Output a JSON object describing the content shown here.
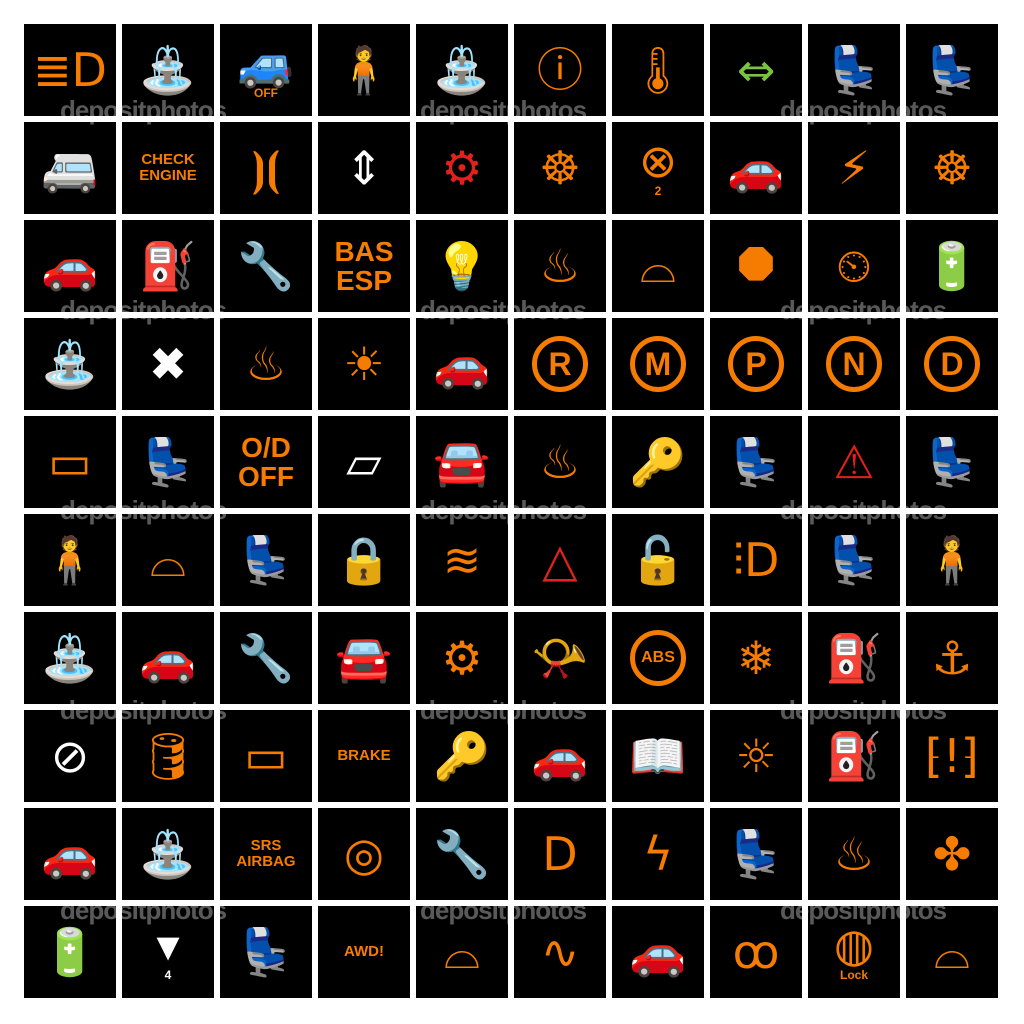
{
  "colors": {
    "orange": "#f57c00",
    "white": "#ffffff",
    "red": "#e3201b",
    "green": "#7cc242",
    "background": "#000000"
  },
  "watermark": "depositphotos",
  "icons": [
    {
      "name": "high-beam",
      "color": "orange"
    },
    {
      "name": "windshield-washer",
      "color": "orange"
    },
    {
      "name": "hill-descent-off",
      "color": "orange",
      "label": "OFF"
    },
    {
      "name": "seatbelt",
      "color": "orange"
    },
    {
      "name": "washer-wiper",
      "color": "orange"
    },
    {
      "name": "brake-warning",
      "color": "orange"
    },
    {
      "name": "coolant-temperature",
      "color": "orange"
    },
    {
      "name": "turn-signals",
      "color": "green"
    },
    {
      "name": "passenger-airbag",
      "color": "orange"
    },
    {
      "name": "side-airbag",
      "color": "orange"
    },
    {
      "name": "car-side",
      "color": "orange"
    },
    {
      "name": "check-engine",
      "color": "orange",
      "text": "CHECK\nENGINE"
    },
    {
      "name": "parking-lights",
      "color": "orange"
    },
    {
      "name": "power-window",
      "color": "white"
    },
    {
      "name": "transmission-warning",
      "color": "red"
    },
    {
      "name": "steering-wheel",
      "color": "orange"
    },
    {
      "name": "airbag-off",
      "color": "orange",
      "label": "2"
    },
    {
      "name": "hood-open",
      "color": "orange"
    },
    {
      "name": "fuse",
      "color": "orange"
    },
    {
      "name": "steering-wheel-lock",
      "color": "orange"
    },
    {
      "name": "convertible",
      "color": "orange"
    },
    {
      "name": "low-fuel",
      "color": "orange"
    },
    {
      "name": "wrench",
      "color": "orange"
    },
    {
      "name": "bas-esp",
      "color": "orange",
      "text": "BAS\nESP",
      "big": true
    },
    {
      "name": "bulb-failure",
      "color": "orange"
    },
    {
      "name": "seat-heater",
      "color": "orange"
    },
    {
      "name": "windshield-wiper",
      "color": "orange"
    },
    {
      "name": "brake-pad",
      "color": "orange"
    },
    {
      "name": "cruise-control",
      "color": "orange"
    },
    {
      "name": "battery",
      "color": "orange"
    },
    {
      "name": "washer-fluid",
      "color": "orange"
    },
    {
      "name": "window-fault",
      "color": "white"
    },
    {
      "name": "rear-defrost",
      "color": "orange"
    },
    {
      "name": "interior-light",
      "color": "orange"
    },
    {
      "name": "sedan",
      "color": "orange"
    },
    {
      "name": "gear-r",
      "color": "orange",
      "circle": "R"
    },
    {
      "name": "gear-m",
      "color": "orange",
      "circle": "M"
    },
    {
      "name": "gear-p",
      "color": "orange",
      "circle": "P"
    },
    {
      "name": "gear-n",
      "color": "orange",
      "circle": "N"
    },
    {
      "name": "gear-d",
      "color": "orange",
      "circle": "D"
    },
    {
      "name": "rear-wiper",
      "color": "orange"
    },
    {
      "name": "passenger-seat",
      "color": "orange"
    },
    {
      "name": "overdrive-off",
      "color": "orange",
      "text": "O/D\nOFF",
      "big": true
    },
    {
      "name": "door-open",
      "color": "white"
    },
    {
      "name": "traction-control",
      "color": "orange"
    },
    {
      "name": "rear-window-defrost",
      "color": "orange"
    },
    {
      "name": "child-lock",
      "color": "white"
    },
    {
      "name": "seat-heating",
      "color": "orange"
    },
    {
      "name": "warning-triangle",
      "color": "red"
    },
    {
      "name": "seatbelt-airbag",
      "color": "orange"
    },
    {
      "name": "airbag-passenger",
      "color": "orange"
    },
    {
      "name": "windshield-defrost",
      "color": "orange"
    },
    {
      "name": "child-seat",
      "color": "orange"
    },
    {
      "name": "car-lock",
      "color": "orange"
    },
    {
      "name": "washer-level",
      "color": "orange"
    },
    {
      "name": "hazard",
      "color": "red"
    },
    {
      "name": "door-locks",
      "color": "orange"
    },
    {
      "name": "fog-light",
      "color": "orange"
    },
    {
      "name": "ventilated-seat",
      "color": "orange"
    },
    {
      "name": "airbag-person",
      "color": "orange"
    },
    {
      "name": "rear-washer",
      "color": "orange"
    },
    {
      "name": "trunk-open",
      "color": "orange"
    },
    {
      "name": "service-wrench",
      "color": "orange"
    },
    {
      "name": "doors-open",
      "color": "orange"
    },
    {
      "name": "engine",
      "color": "orange"
    },
    {
      "name": "horn",
      "color": "orange"
    },
    {
      "name": "abs",
      "color": "orange",
      "circle": "ABS"
    },
    {
      "name": "snowflake",
      "color": "orange"
    },
    {
      "name": "fuel-pump",
      "color": "orange"
    },
    {
      "name": "isofix",
      "color": "orange"
    },
    {
      "name": "no-child-seat",
      "color": "white"
    },
    {
      "name": "oil-pressure",
      "color": "orange"
    },
    {
      "name": "wiper-fault",
      "color": "orange"
    },
    {
      "name": "brake",
      "color": "orange",
      "text": "BRAKE"
    },
    {
      "name": "key",
      "color": "orange"
    },
    {
      "name": "car-service",
      "color": "orange"
    },
    {
      "name": "manual-info",
      "color": "white"
    },
    {
      "name": "bulb-warning",
      "color": "orange"
    },
    {
      "name": "no-fuel",
      "color": "orange"
    },
    {
      "name": "tire-pressure",
      "color": "orange"
    },
    {
      "name": "hatchback",
      "color": "orange"
    },
    {
      "name": "front-washer",
      "color": "orange"
    },
    {
      "name": "srs-airbag",
      "color": "orange",
      "text": "SRS\nAIRBAG"
    },
    {
      "name": "brake-pad-wear",
      "color": "orange"
    },
    {
      "name": "service-due",
      "color": "orange"
    },
    {
      "name": "low-beam",
      "color": "orange"
    },
    {
      "name": "electric-fault",
      "color": "orange"
    },
    {
      "name": "child-seat-belt",
      "color": "orange"
    },
    {
      "name": "windshield-heater",
      "color": "orange"
    },
    {
      "name": "fan",
      "color": "orange"
    },
    {
      "name": "battery-charge",
      "color": "orange"
    },
    {
      "name": "window-4",
      "color": "white",
      "label": "4"
    },
    {
      "name": "seat-person",
      "color": "orange"
    },
    {
      "name": "awd-warning",
      "color": "orange",
      "text": "AWD!"
    },
    {
      "name": "wiper",
      "color": "orange"
    },
    {
      "name": "exhaust-heat",
      "color": "orange"
    },
    {
      "name": "car-silhouette",
      "color": "orange"
    },
    {
      "name": "glow-plug",
      "color": "orange"
    },
    {
      "name": "steering-lock",
      "color": "orange",
      "label": "Lock"
    },
    {
      "name": "wiper-rear",
      "color": "orange"
    }
  ]
}
